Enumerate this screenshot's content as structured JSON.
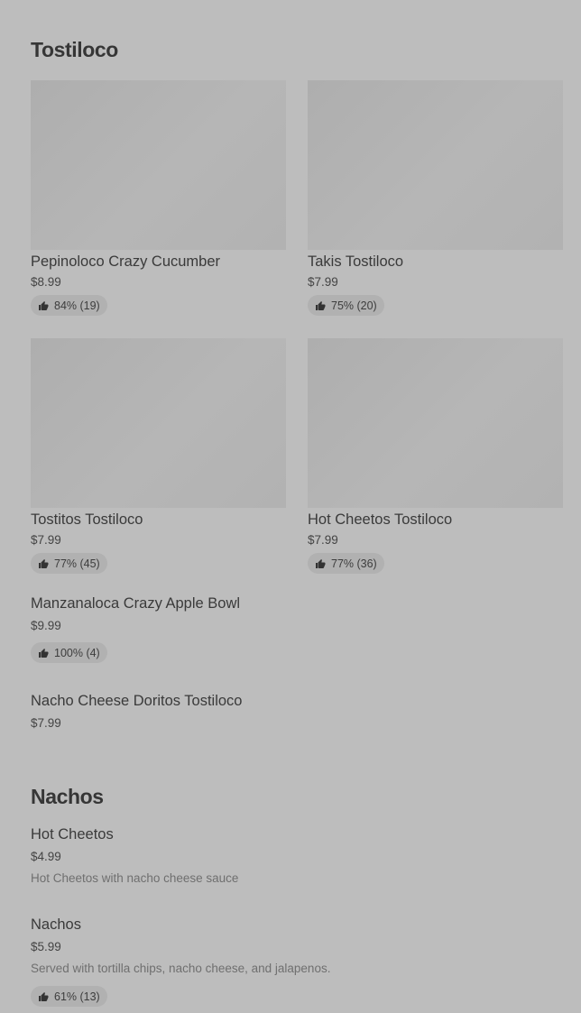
{
  "sections": [
    {
      "title": "Tostiloco",
      "cards": [
        {
          "name": "Pepinoloco Crazy Cucumber",
          "price": "$8.99",
          "rating": "84% (19)"
        },
        {
          "name": "Takis Tostiloco",
          "price": "$7.99",
          "rating": "75% (20)"
        },
        {
          "name": "Tostitos Tostiloco",
          "price": "$7.99",
          "rating": "77% (45)"
        },
        {
          "name": "Hot Cheetos Tostiloco",
          "price": "$7.99",
          "rating": "77% (36)"
        }
      ],
      "items": [
        {
          "name": "Manzanaloca Crazy Apple Bowl",
          "price": "$9.99",
          "rating": "100% (4)"
        },
        {
          "name": "Nacho Cheese Doritos Tostiloco",
          "price": "$7.99"
        }
      ]
    },
    {
      "title": "Nachos",
      "items": [
        {
          "name": "Hot Cheetos",
          "price": "$4.99",
          "description": "Hot Cheetos with nacho cheese sauce"
        },
        {
          "name": "Nachos",
          "price": "$5.99",
          "description": "Served with tortilla chips, nacho cheese, and jalapenos.",
          "rating": "61% (13)"
        }
      ]
    }
  ],
  "icons": {
    "rating": "thumbs-up-icon"
  },
  "colors": {
    "background": "#bdbdbd",
    "badge": "#b1b1b1",
    "image_placeholder": "#b2b2b2"
  }
}
